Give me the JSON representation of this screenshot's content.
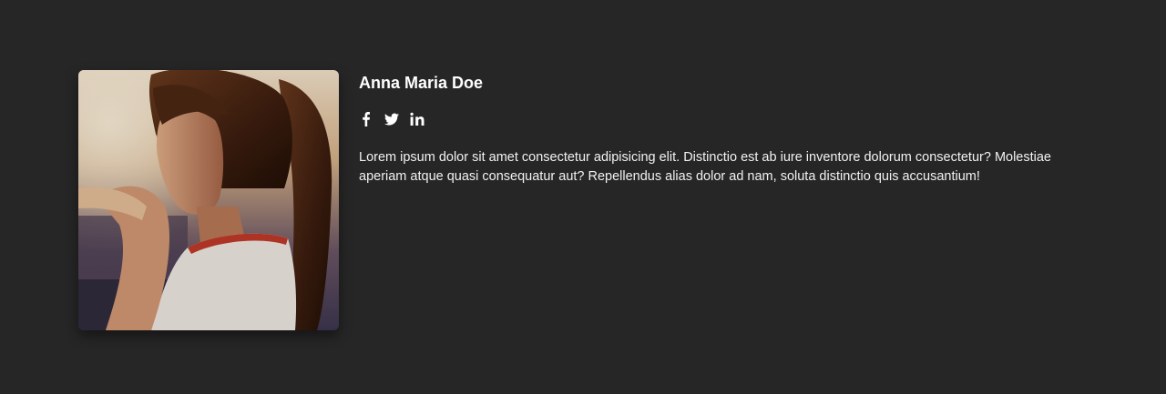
{
  "profile": {
    "name": "Anna Maria Doe",
    "bio": "Lorem ipsum dolor sit amet consectetur adipisicing elit. Distinctio est ab iure inventore dolorum consectetur? Molestiae aperiam atque quasi consequatur aut? Repellendus alias dolor ad nam, soluta distinctio quis accusantium!",
    "photo_subject": "portrait of a young woman with a ponytail at sunset"
  },
  "socials": [
    {
      "icon": "facebook-icon"
    },
    {
      "icon": "twitter-icon"
    },
    {
      "icon": "linkedin-icon"
    }
  ],
  "colors": {
    "background": "#262626",
    "text": "#ffffff"
  }
}
